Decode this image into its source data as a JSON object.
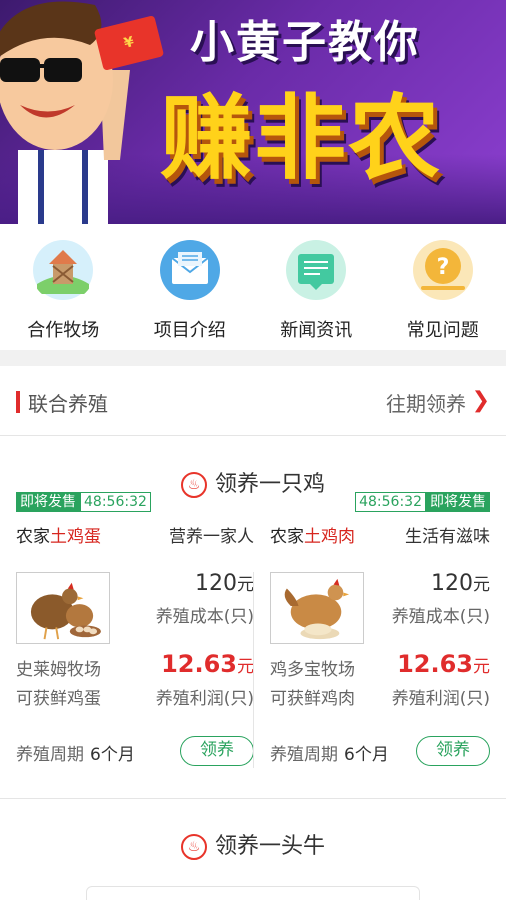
{
  "banner": {
    "title_line1": "小黄子教你",
    "title_line2": "赚非农",
    "envelope_text": "¥"
  },
  "nav": [
    {
      "label": "合作牧场",
      "icon": "ranch-icon",
      "color": "#5cc0e8"
    },
    {
      "label": "项目介绍",
      "icon": "mail-icon",
      "color": "#4fa8e6"
    },
    {
      "label": "新闻资讯",
      "icon": "news-icon",
      "color": "#43c9a0"
    },
    {
      "label": "常见问题",
      "icon": "question-icon",
      "color": "#f3b63a"
    }
  ],
  "section": {
    "title": "联合养殖",
    "more": "往期领养",
    "chevron": "❯"
  },
  "chicken_block": {
    "title": "领养一只鸡",
    "cards": [
      {
        "tag_status": "即将发售",
        "tag_timer": "48:56:32",
        "name_prefix": "农家",
        "name_highlight": "土鸡蛋",
        "slogan": "营养一家人",
        "price": "120",
        "price_unit": "元",
        "cost_label": "养殖成本(只)",
        "farm": "史莱姆牧场",
        "profit": "12.63",
        "profit_unit": "元",
        "gain": "可获鲜鸡蛋",
        "profit_label": "养殖利润(只)",
        "period_label": "养殖周期",
        "period_value": "6个月",
        "button": "领养"
      },
      {
        "tag_status": "即将发售",
        "tag_timer": "48:56:32",
        "name_prefix": "农家",
        "name_highlight": "土鸡肉",
        "slogan": "生活有滋味",
        "price": "120",
        "price_unit": "元",
        "cost_label": "养殖成本(只)",
        "farm": "鸡多宝牧场",
        "profit": "12.63",
        "profit_unit": "元",
        "gain": "可获鲜鸡肉",
        "profit_label": "养殖利润(只)",
        "period_label": "养殖周期",
        "period_value": "6个月",
        "button": "领养"
      }
    ]
  },
  "cow_block": {
    "title": "领养一头牛"
  },
  "colors": {
    "accent_red": "#e02c2c",
    "accent_green": "#2aa35e",
    "banner_purple": "#6a2ba8",
    "banner_yellow": "#ffd21a"
  }
}
